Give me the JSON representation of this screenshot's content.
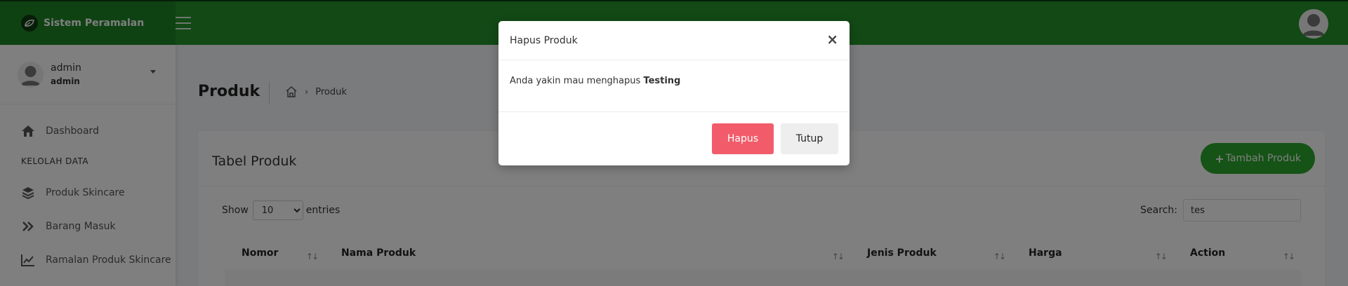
{
  "brand": {
    "name": "Sistem Peramalan",
    "icon": "leaf-logo-icon"
  },
  "colors": {
    "header": "#24922a",
    "brand_panel": "#1f8525",
    "primary_button": "#2aa62d",
    "danger_button": "#f25c6a"
  },
  "user": {
    "name": "admin",
    "role": "admin"
  },
  "sidebar": {
    "items": [
      {
        "label": "Dashboard",
        "icon": "home-icon"
      },
      {
        "label": "KELOLAH DATA",
        "type": "header"
      },
      {
        "label": "Produk Skincare",
        "icon": "layers-icon"
      },
      {
        "label": "Barang Masuk",
        "icon": "double-chevron-right-icon"
      },
      {
        "label": "Ramalan Produk Skincare",
        "icon": "line-chart-icon"
      }
    ]
  },
  "page": {
    "title": "Produk",
    "breadcrumb_current": "Produk"
  },
  "card": {
    "title": "Tabel Produk",
    "add_button": "Tambah Produk",
    "show_label": "Show",
    "entries_label": "entries",
    "page_length": "10",
    "search_label": "Search:",
    "search_value": "tes",
    "columns": [
      "Nomor",
      "Nama Produk",
      "Jenis Produk",
      "Harga",
      "Action"
    ]
  },
  "modal": {
    "title": "Hapus Produk",
    "message_prefix": "Anda yakin mau menghapus",
    "product_name": "Testing",
    "delete_button": "Hapus",
    "close_button": "Tutup"
  }
}
